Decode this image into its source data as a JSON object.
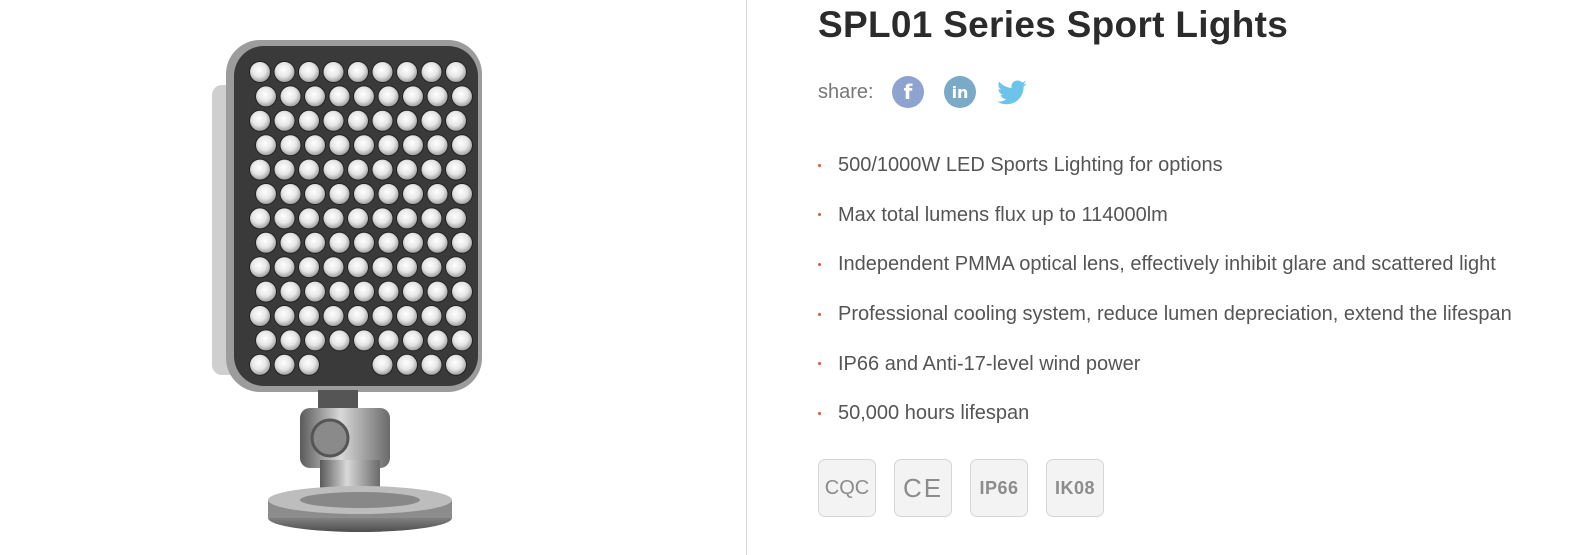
{
  "product": {
    "title": "SPL01 Series Sport Lights",
    "image_alt": "SPL01 sport light fixture"
  },
  "share": {
    "label": "share:",
    "networks": [
      {
        "name": "facebook",
        "glyph": "f",
        "color": "#8ea3cf"
      },
      {
        "name": "linkedin",
        "glyph": "in",
        "color": "#7aaac8"
      },
      {
        "name": "twitter",
        "icon": "bird-icon",
        "color": "#6cc4ea"
      }
    ]
  },
  "features": [
    "500/1000W LED Sports Lighting for options",
    "Max total lumens flux up to 114000lm",
    "Independent PMMA optical lens, effectively inhibit glare and scattered light",
    "Professional cooling system, reduce lumen depreciation, extend the lifespan",
    "IP66 and Anti-17-level wind power",
    "50,000 hours lifespan"
  ],
  "certifications": [
    "CQC",
    "CE",
    "IP66",
    "IK08"
  ],
  "colors": {
    "bullet": "#e2562a",
    "title": "#2b2b2b",
    "text": "#555555"
  }
}
